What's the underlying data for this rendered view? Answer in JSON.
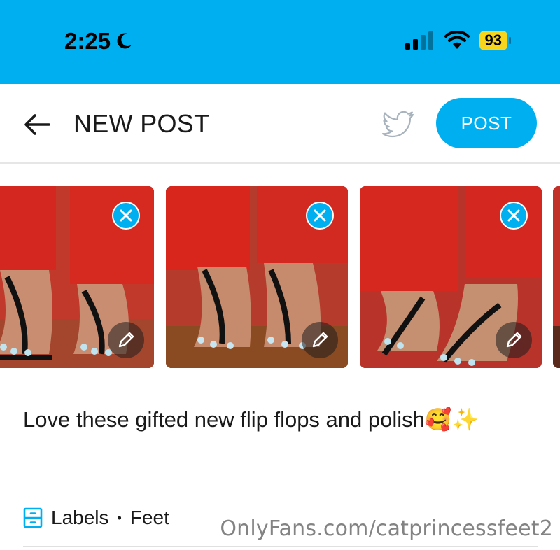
{
  "status_bar": {
    "time": "2:25",
    "battery": "93",
    "colors": {
      "background": "#00aff0",
      "battery_badge": "#f7d51d"
    }
  },
  "header": {
    "title": "NEW POST",
    "post_label": "POST",
    "icons": {
      "back": "arrow-left-icon",
      "twitter": "twitter-icon"
    }
  },
  "media": [
    {
      "name": "photo-1"
    },
    {
      "name": "photo-2"
    },
    {
      "name": "photo-3"
    },
    {
      "name": "photo-4"
    }
  ],
  "caption": "Love these gifted new flip flops and polish🥰✨",
  "labels": {
    "label": "Labels",
    "separator": "•",
    "value": "Feet",
    "icon": "labels-cabinet-icon"
  },
  "watermark": "OnlyFans.com/catprincessfeet2",
  "colors": {
    "accent": "#00aff0"
  }
}
